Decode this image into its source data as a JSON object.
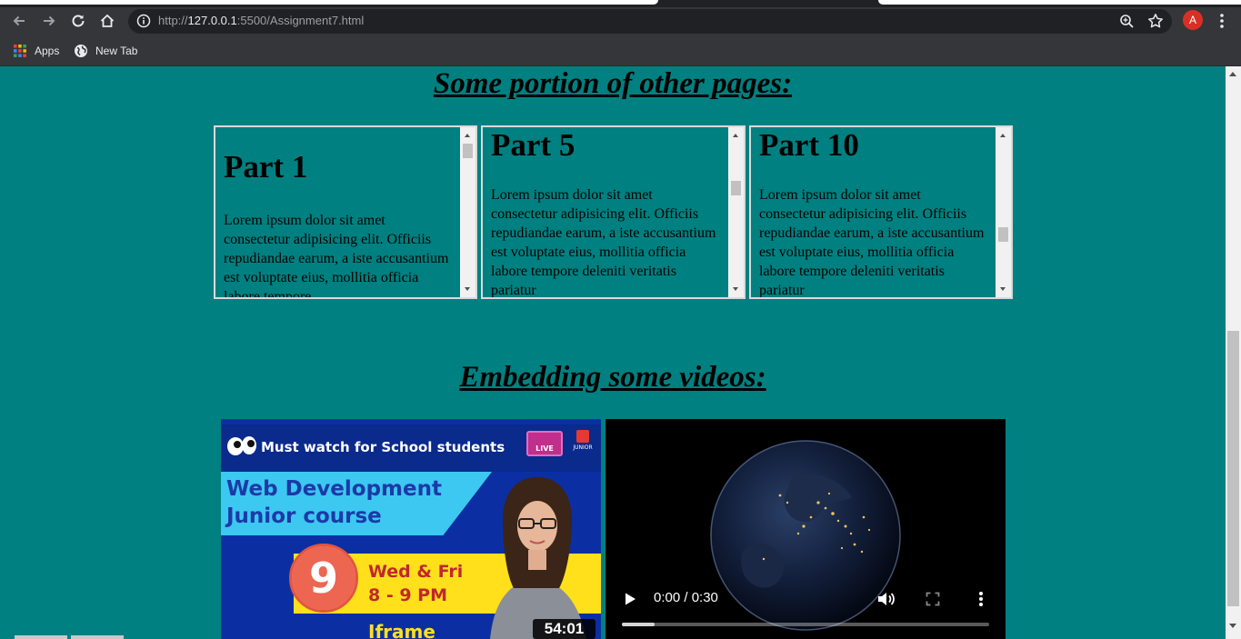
{
  "browser": {
    "url_prefix": "http://",
    "url_host": "127.0.0.1",
    "url_rest": ":5500/Assignment7.html",
    "profile_initial": "A",
    "bookmarks": [
      {
        "label": "Apps",
        "icon": "apps-grid-icon"
      },
      {
        "label": "New Tab",
        "icon": "globe-icon"
      }
    ]
  },
  "colors": {
    "page_background": "#008080",
    "chrome_dark": "#35363a",
    "omnibox": "#202124",
    "avatar": "#d93025"
  },
  "sections": {
    "pages_heading": "Some portion of other pages:",
    "videos_heading": "Embedding some videos:"
  },
  "frames": [
    {
      "title": "Part 1",
      "text": "Lorem ipsum dolor sit amet consectetur adipisicing elit. Officiis repudiandae earum, a iste accusantium est voluptate eius, mollitia officia labore tempore"
    },
    {
      "title": "Part 5",
      "text": "Lorem ipsum dolor sit amet consectetur adipisicing elit. Officiis repudiandae earum, a iste accusantium est voluptate eius, mollitia officia labore tempore deleniti veritatis pariatur"
    },
    {
      "title": "Part 10",
      "text": "Lorem ipsum dolor sit amet consectetur adipisicing elit. Officiis repudiandae earum, a iste accusantium est voluptate eius, mollitia officia labore tempore deleniti veritatis pariatur"
    }
  ],
  "youtube_thumbnail": {
    "tagline": "Must watch for School students",
    "badge": "LIVE",
    "brand": "JUNIOR",
    "course_line1": "Web Development",
    "course_line2": "Junior course",
    "lesson_number": "9",
    "schedule_days": "Wed & Fri",
    "schedule_time": "8 - 9 PM",
    "topic": "Iframe",
    "duration": "54:01"
  },
  "video_player": {
    "time_display": "0:00 / 0:30",
    "buffered_fraction": 0.09
  }
}
